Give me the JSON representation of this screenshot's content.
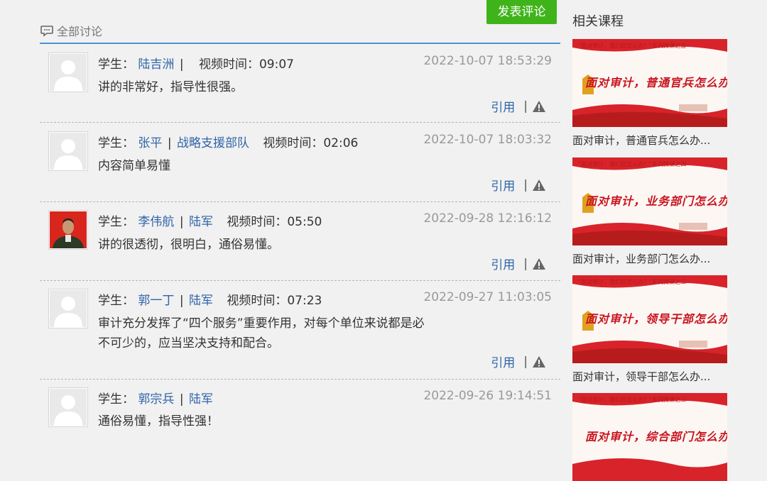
{
  "post_button": "发表评论",
  "section_title": "全部讨论",
  "sidebar_title": "相关课程",
  "quote_label": "引用",
  "comments": [
    {
      "role": "学生：",
      "name": "陆吉洲",
      "org": "",
      "video_label": "视频时间：",
      "video_time": "09:07",
      "date": "2022-10-07 18:53:29",
      "text": "讲的非常好，指导性很强。",
      "avatar": "default"
    },
    {
      "role": "学生：",
      "name": "张平",
      "org": "战略支援部队",
      "video_label": "视频时间：",
      "video_time": "02:06",
      "date": "2022-10-07 18:03:32",
      "text": "内容简单易懂",
      "avatar": "default"
    },
    {
      "role": "学生：",
      "name": "李伟航",
      "org": "陆军",
      "video_label": "视频时间：",
      "video_time": "05:50",
      "date": "2022-09-28 12:16:12",
      "text": "讲的很透彻，很明白，通俗易懂。",
      "avatar": "photo"
    },
    {
      "role": "学生：",
      "name": "郭一丁",
      "org": "陆军",
      "video_label": "视频时间：",
      "video_time": "07:23",
      "date": "2022-09-27 11:03:05",
      "text": "审计充分发挥了“四个服务”重要作用，对每个单位来说都是必不可少的，应当坚决支持和配合。",
      "avatar": "default"
    },
    {
      "role": "学生：",
      "name": "郭宗兵",
      "org": "陆军",
      "video_label": "",
      "video_time": "",
      "date": "2022-09-26 19:14:51",
      "text": "通俗易懂，指导性强！",
      "avatar": "default"
    }
  ],
  "courses": [
    {
      "tag": "“面对审计，我们应怎么办？”系列微课之五",
      "thumb_title": "面对审计，普通官兵怎么办？",
      "caption": "面对审计，普通官兵怎么办..."
    },
    {
      "tag": "“面对审计，我们应怎么办？”系列微课之四",
      "thumb_title": "面对审计，业务部门怎么办？",
      "caption": "面对审计，业务部门怎么办..."
    },
    {
      "tag": "“面对审计，我们应怎么办？”系列微课之二",
      "thumb_title": "面对审计，领导干部怎么办？",
      "caption": "面对审计，领导干部怎么办..."
    },
    {
      "tag": "“面对审计，我们应怎么办？”系列微课之三",
      "thumb_title": "面对审计，综合部门怎么办？",
      "caption": ""
    }
  ],
  "colors": {
    "accent_green": "#3fb41a",
    "link_blue": "#2f64a8",
    "rule_blue": "#4a90d9",
    "thumb_red": "#c8141e"
  }
}
